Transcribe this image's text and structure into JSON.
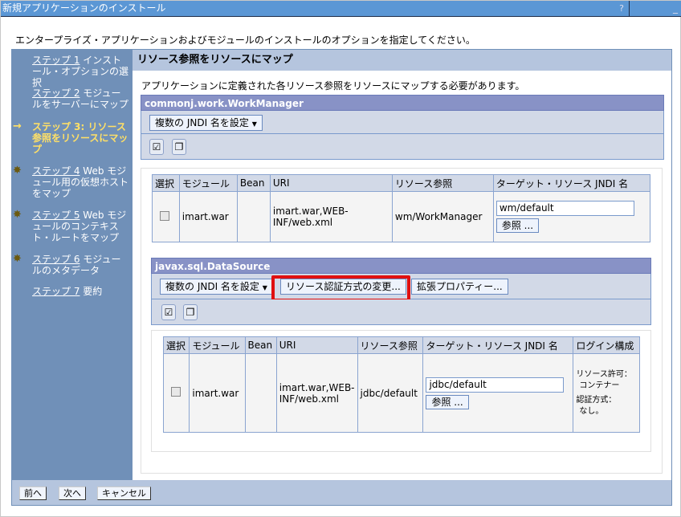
{
  "window": {
    "title": "新規アプリケーションのインストール",
    "help": "?",
    "minimize": "_"
  },
  "intro": "エンタープライズ・アプリケーションおよびモジュールのインストールのオプションを指定してください。",
  "steps": [
    {
      "num": "ステップ 1",
      "label": "インストール・オプションの選択",
      "state": "link"
    },
    {
      "num": "ステップ 2",
      "label": "モジュールをサーバーにマップ",
      "state": "link"
    },
    {
      "num": "ステップ 3:",
      "label": "リソース参照をリソースにマップ",
      "state": "current"
    },
    {
      "num": "ステップ 4",
      "label": "Web モジュール用の仮想ホストをマップ",
      "state": "required"
    },
    {
      "num": "ステップ 5",
      "label": "Web モジュールのコンテキスト・ルートをマップ",
      "state": "required"
    },
    {
      "num": "ステップ 6",
      "label": "モジュールのメタデータ",
      "state": "required"
    },
    {
      "num": "ステップ 7",
      "label": "要約",
      "state": "link"
    }
  ],
  "main": {
    "title": "リソース参照をリソースにマップ",
    "description": "アプリケーションに定義された各リソース参照をリソースにマップする必要があります。"
  },
  "sections": [
    {
      "title": "commonj.work.WorkManager",
      "buttons": [
        "複数の JNDI 名を設定"
      ],
      "columns": [
        "選択",
        "モジュール",
        "Bean",
        "URI",
        "リソース参照",
        "ターゲット・リソース JNDI 名"
      ],
      "row": {
        "module": "imart.war",
        "bean": "",
        "uri": "imart.war,WEB-INF/web.xml",
        "ref": "wm/WorkManager",
        "jndi": "wm/default",
        "browse": "参照 ..."
      }
    },
    {
      "title": "javax.sql.DataSource",
      "buttons": [
        "複数の JNDI 名を設定",
        "リソース認証方式の変更...",
        "拡張プロパティー..."
      ],
      "columns": [
        "選択",
        "モジュール",
        "Bean",
        "URI",
        "リソース参照",
        "ターゲット・リソース JNDI 名",
        "ログイン構成"
      ],
      "row": {
        "module": "imart.war",
        "bean": "",
        "uri": "imart.war,WEB-INF/web.xml",
        "ref": "jdbc/default",
        "jndi": "jdbc/default",
        "browse": "参照 ...",
        "login_l1": "リソース許可：",
        "login_l2": "コンテナー",
        "login_l3": "認証方式：",
        "login_l4": "なし。"
      }
    }
  ],
  "footer": {
    "prev": "前へ",
    "next": "次へ",
    "cancel": "キャンセル"
  },
  "highlight_color": "#e01010"
}
